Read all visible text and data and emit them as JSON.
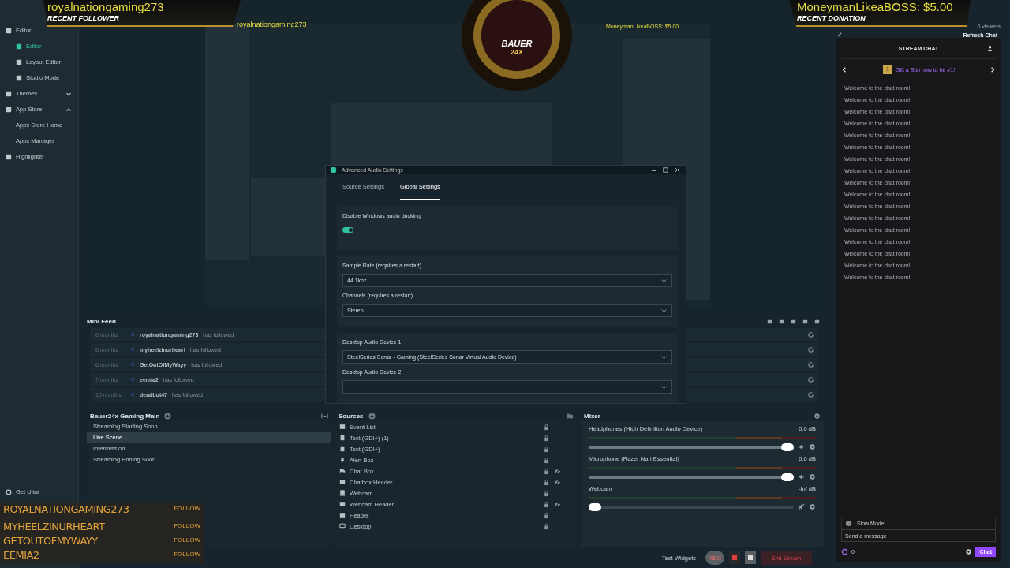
{
  "overlay": {
    "follower_name": "royalnationgaming273",
    "follower_caption": "RECENT FOLLOWER",
    "donation": "MoneymanLikeaBOSS: $5.00",
    "donation_caption": "RECENT DONATION",
    "logo_text": "BAUER",
    "logo_sub": "24X"
  },
  "nested_preview": {
    "follower_name": "royalnationgaming273",
    "donation": "MoneymanLikeaBOSS: $5.00"
  },
  "sidebar": {
    "items": [
      {
        "label": "Editor",
        "kind": "section",
        "selected": false
      },
      {
        "label": "Editor",
        "kind": "page",
        "selected": true
      },
      {
        "label": "Layout Editor",
        "kind": "page",
        "selected": false
      },
      {
        "label": "Studio Mode",
        "kind": "page",
        "selected": false
      },
      {
        "label": "Themes",
        "kind": "section",
        "selected": false,
        "expanded": false
      },
      {
        "label": "App Store",
        "kind": "section",
        "selected": false,
        "expanded": true
      },
      {
        "label": "Apps Store Home",
        "kind": "sub",
        "selected": false
      },
      {
        "label": "Apps Manager",
        "kind": "sub",
        "selected": false
      },
      {
        "label": "Highlighter",
        "kind": "section",
        "selected": false
      }
    ],
    "footer": "Get Ultra"
  },
  "follow_overlay": {
    "items": [
      {
        "name": "ROYALNATIONGAMING273",
        "action": "FOLLOW"
      },
      {
        "name": "MYHEELZINURHEART",
        "action": "FOLLOW"
      },
      {
        "name": "GETOUTOFMYWAYY",
        "action": "FOLLOW"
      },
      {
        "name": "EEMIA2",
        "action": "FOLLOW"
      }
    ]
  },
  "mini_feed": {
    "title": "Mini Feed",
    "rows": [
      {
        "time": "6 months",
        "name": "royalnationgaming273",
        "action": "has followed"
      },
      {
        "time": "6 months",
        "name": "myheelzinurheart",
        "action": "has followed"
      },
      {
        "time": "6 months",
        "name": "GetOutOfMyWayy",
        "action": "has followed"
      },
      {
        "time": "7 months",
        "name": "eemia2",
        "action": "has followed"
      },
      {
        "time": "10 months",
        "name": "deadbot47",
        "action": "has followed"
      }
    ]
  },
  "scenes": {
    "title": "Bauer24x Gaming Main",
    "items": [
      {
        "label": "Streaming Starting Soon",
        "selected": false
      },
      {
        "label": "Live Scene",
        "selected": true
      },
      {
        "label": "Intermission",
        "selected": false
      },
      {
        "label": "Streaming Ending Soon",
        "selected": false
      }
    ]
  },
  "sources": {
    "title": "Sources",
    "items": [
      {
        "label": "Event List",
        "kind": "list",
        "hidden": false
      },
      {
        "label": "Text (GDI+) (1)",
        "kind": "text",
        "hidden": false
      },
      {
        "label": "Text (GDI+)",
        "kind": "text",
        "hidden": false
      },
      {
        "label": "Alert Box",
        "kind": "alert",
        "hidden": false
      },
      {
        "label": "Chat Box",
        "kind": "chat",
        "hidden": true
      },
      {
        "label": "Chatbox Header",
        "kind": "image",
        "hidden": true
      },
      {
        "label": "Webcam",
        "kind": "webcam",
        "hidden": false
      },
      {
        "label": "Webcam Header",
        "kind": "image",
        "hidden": true
      },
      {
        "label": "Header",
        "kind": "image",
        "hidden": false
      },
      {
        "label": "Desktop",
        "kind": "display",
        "hidden": false
      }
    ]
  },
  "mixer": {
    "title": "Mixer",
    "channels": [
      {
        "name": "Headphones (High Definition Audio Device)",
        "reading": "0.0 dB",
        "level": 1,
        "muted": false
      },
      {
        "name": "Microphone (Razer Nari Essential)",
        "reading": "0.0 dB",
        "level": 1,
        "muted": false
      },
      {
        "name": "Webcam",
        "reading": "-Inf dB",
        "level": 0,
        "muted": true
      }
    ]
  },
  "footer_bar": {
    "test_widgets": "Test Widgets",
    "rec": "REC",
    "end_stream": "End Stream"
  },
  "dialog": {
    "title": "Advanced Audio Settings",
    "tabs": [
      {
        "label": "Source Settings",
        "selected": false
      },
      {
        "label": "Global Settings",
        "selected": true
      }
    ],
    "toggle": {
      "label": "Disable Windows audio ducking",
      "on": true
    },
    "selects": [
      {
        "label": "Sample Rate (requires a restart)",
        "value": "44.1khz"
      },
      {
        "label": "Channels (requires a restart)",
        "value": "Stereo"
      },
      {
        "label": "Desktop Audio Device 1",
        "value": "SteelSeries Sonar - Gaming (SteelSeries Sonar Virtual Audio Device)"
      },
      {
        "label": "Desktop Audio Device 2"
      }
    ]
  },
  "chat": {
    "viewers": "0 viewers",
    "refresh": "Refresh Chat",
    "title": "STREAM CHAT",
    "gift": "Gift a Sub now to be #1!",
    "gift_number": "1",
    "messages": [
      "Welcome to the chat room!",
      "Welcome to the chat room!",
      "Welcome to the chat room!",
      "Welcome to the chat room!",
      "Welcome to the chat room!",
      "Welcome to the chat room!",
      "Welcome to the chat room!",
      "Welcome to the chat room!",
      "Welcome to the chat room!",
      "Welcome to the chat room!",
      "Welcome to the chat room!",
      "Welcome to the chat room!",
      "Welcome to the chat room!",
      "Welcome to the chat room!",
      "Welcome to the chat room!",
      "Welcome to the chat room!",
      "Welcome to the chat room!"
    ],
    "slow_mode": "Slow Mode",
    "placeholder": "Send a message",
    "points": "0",
    "send": "Chat"
  }
}
